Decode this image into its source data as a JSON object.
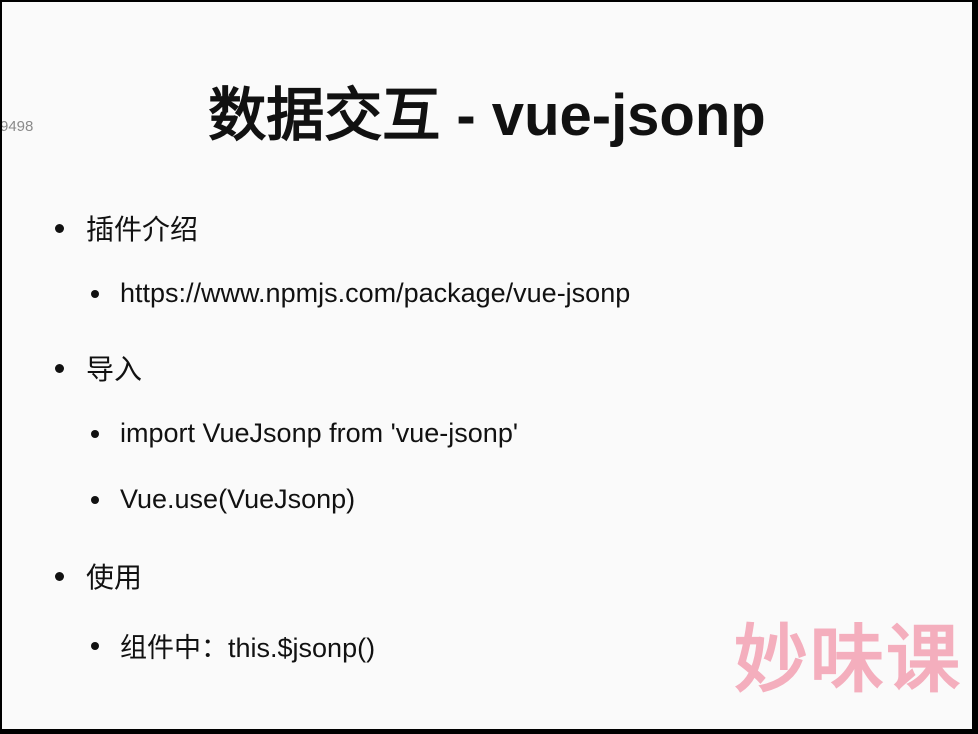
{
  "side_number": "9498",
  "slide": {
    "title": "数据交互 - vue-jsonp",
    "items": [
      {
        "level": 1,
        "text": "插件介绍"
      },
      {
        "level": 2,
        "text": "https://www.npmjs.com/package/vue-jsonp"
      },
      {
        "level": 1,
        "text": "导入"
      },
      {
        "level": 2,
        "text": "import VueJsonp from 'vue-jsonp'"
      },
      {
        "level": 2,
        "text": "Vue.use(VueJsonp)"
      },
      {
        "level": 1,
        "text": "使用"
      },
      {
        "level": 2,
        "text": "组件中：this.$jsonp()"
      }
    ]
  },
  "watermark": "妙味课",
  "colors": {
    "background": "#fafafa",
    "text": "#111111",
    "watermark": "#f3a1b3"
  }
}
